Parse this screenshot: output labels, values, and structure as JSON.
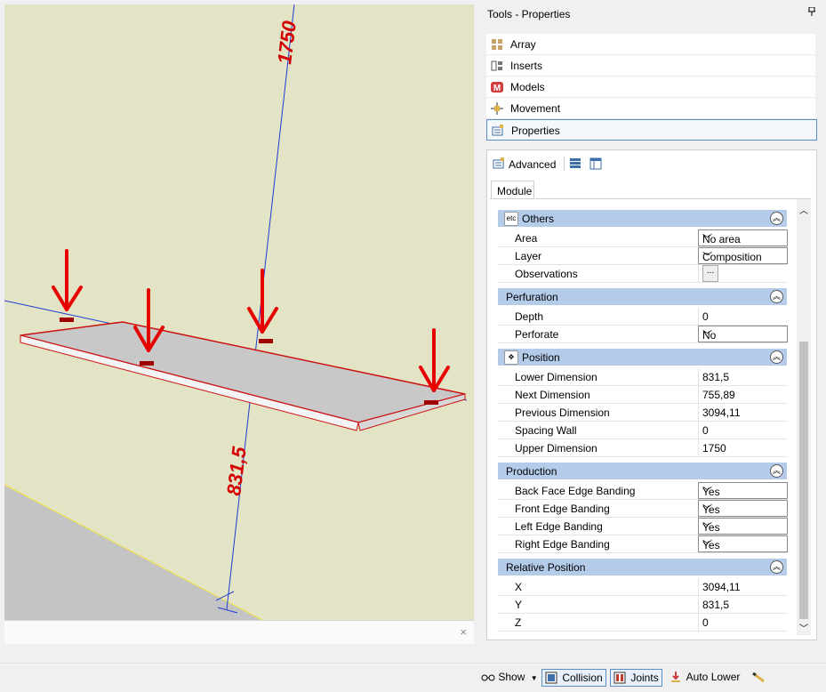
{
  "panel": {
    "title": "Tools - Properties",
    "pin_icon": "pin-icon",
    "tools": [
      {
        "label": "Array",
        "icon": "array-icon"
      },
      {
        "label": "Inserts",
        "icon": "inserts-icon"
      },
      {
        "label": "Models",
        "icon": "models-icon"
      },
      {
        "label": "Movement",
        "icon": "movement-icon"
      },
      {
        "label": "Properties",
        "icon": "properties-icon",
        "active": true
      }
    ]
  },
  "properties": {
    "advanced_label": "Advanced",
    "tab_module": "Module",
    "categories": {
      "others": {
        "title": "Others",
        "icon_text": "etc"
      },
      "perfuration": {
        "title": "Perfuration"
      },
      "position": {
        "title": "Position"
      },
      "production": {
        "title": "Production"
      },
      "relative_position": {
        "title": "Relative Position"
      }
    },
    "rows": {
      "area": {
        "name": "Area",
        "value": "No area"
      },
      "layer": {
        "name": "Layer",
        "value": "Composition"
      },
      "observations": {
        "name": "Observations",
        "value": "",
        "button": "..."
      },
      "depth": {
        "name": "Depth",
        "value": "0"
      },
      "perforate": {
        "name": "Perforate",
        "value": "No"
      },
      "lower_dimension": {
        "name": "Lower Dimension",
        "value": "831,5"
      },
      "next_dimension": {
        "name": "Next Dimension",
        "value": "755,89"
      },
      "previous_dimension": {
        "name": "Previous Dimension",
        "value": "3094,11"
      },
      "spacing_wall": {
        "name": "Spacing Wall",
        "value": "0"
      },
      "upper_dimension": {
        "name": "Upper Dimension",
        "value": "1750"
      },
      "back_face_edge": {
        "name": "Back Face Edge Banding",
        "value": "Yes"
      },
      "front_edge": {
        "name": "Front Edge Banding",
        "value": "Yes"
      },
      "left_edge": {
        "name": "Left Edge Banding",
        "value": "Yes"
      },
      "right_edge": {
        "name": "Right Edge Banding",
        "value": "Yes"
      },
      "x": {
        "name": "X",
        "value": "3094,11"
      },
      "y": {
        "name": "Y",
        "value": "831,5"
      },
      "z": {
        "name": "Z",
        "value": "0"
      }
    }
  },
  "viewport": {
    "dim_upper": "1750",
    "dim_lower": "831,5",
    "close_label": "×"
  },
  "statusbar": {
    "show_label": "Show",
    "collision_label": "Collision",
    "joints_label": "Joints",
    "auto_lower_label": "Auto Lower"
  },
  "colors": {
    "accent": "#5a8fc7",
    "category": "#b4ccea",
    "viewport_bg": "#e3e3c5",
    "dimension_text": "#d40000",
    "dimension_line": "#1e3cd2"
  }
}
